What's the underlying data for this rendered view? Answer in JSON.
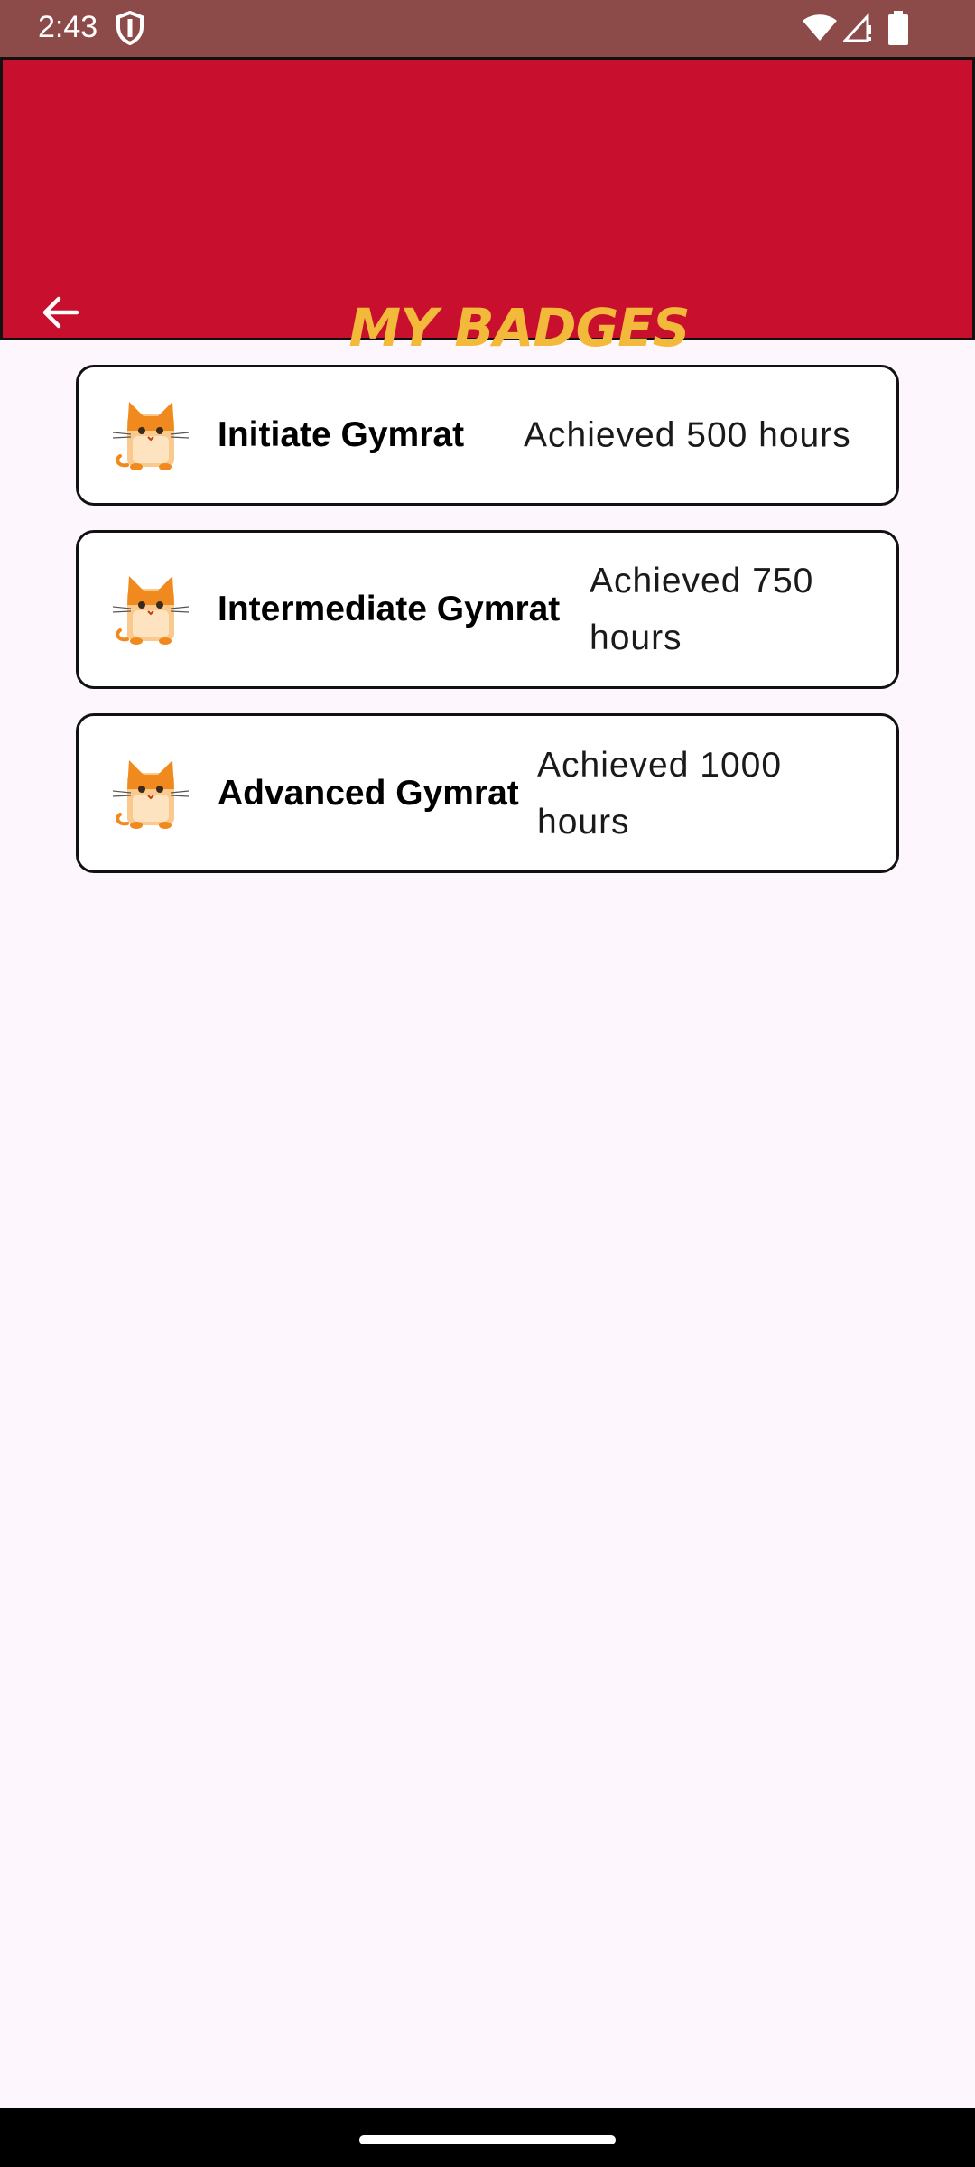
{
  "status_bar": {
    "time": "2:43",
    "icons": [
      "shield-icon",
      "wifi-icon",
      "signal-icon",
      "battery-icon"
    ]
  },
  "app_bar": {
    "title": "MY BADGES",
    "back_icon": "arrow-left-icon",
    "background_color": "#c8102e",
    "title_color": "#f2b93b"
  },
  "badges": [
    {
      "name": "Initiate Gymrat",
      "description": "Achieved 500 hours",
      "icon": "cat-icon"
    },
    {
      "name": "Intermediate Gymrat",
      "description": "Achieved 750 hours",
      "icon": "cat-icon"
    },
    {
      "name": "Advanced Gymrat",
      "description": "Achieved 1000 hours",
      "icon": "cat-icon"
    }
  ]
}
